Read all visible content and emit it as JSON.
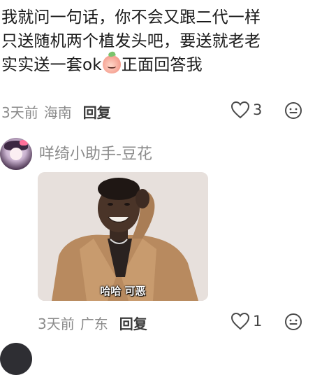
{
  "comment1": {
    "text_lines": [
      "我就问一句话，你不会又跟二代一样",
      "只送随机两个植发头吧，要送就老老",
      "实实送一套ok"
    ],
    "text_tail": "正面回答我",
    "emoji": "peach-face-emoji",
    "time": "3天前",
    "location": "海南",
    "reply_label": "回复",
    "likes": "3"
  },
  "comment2": {
    "username": "咩绮小助手-豆花",
    "image_caption": "哈哈 可恶",
    "time": "3天前",
    "location": "广东",
    "reply_label": "回复",
    "likes": "1"
  },
  "icons": {
    "like": "heart-outline-icon",
    "more": "smiley-face-icon"
  },
  "colors": {
    "meta_text": "#8b8b8b",
    "body_text": "#1a1a1a",
    "icon_stroke": "#4a4a4a"
  }
}
